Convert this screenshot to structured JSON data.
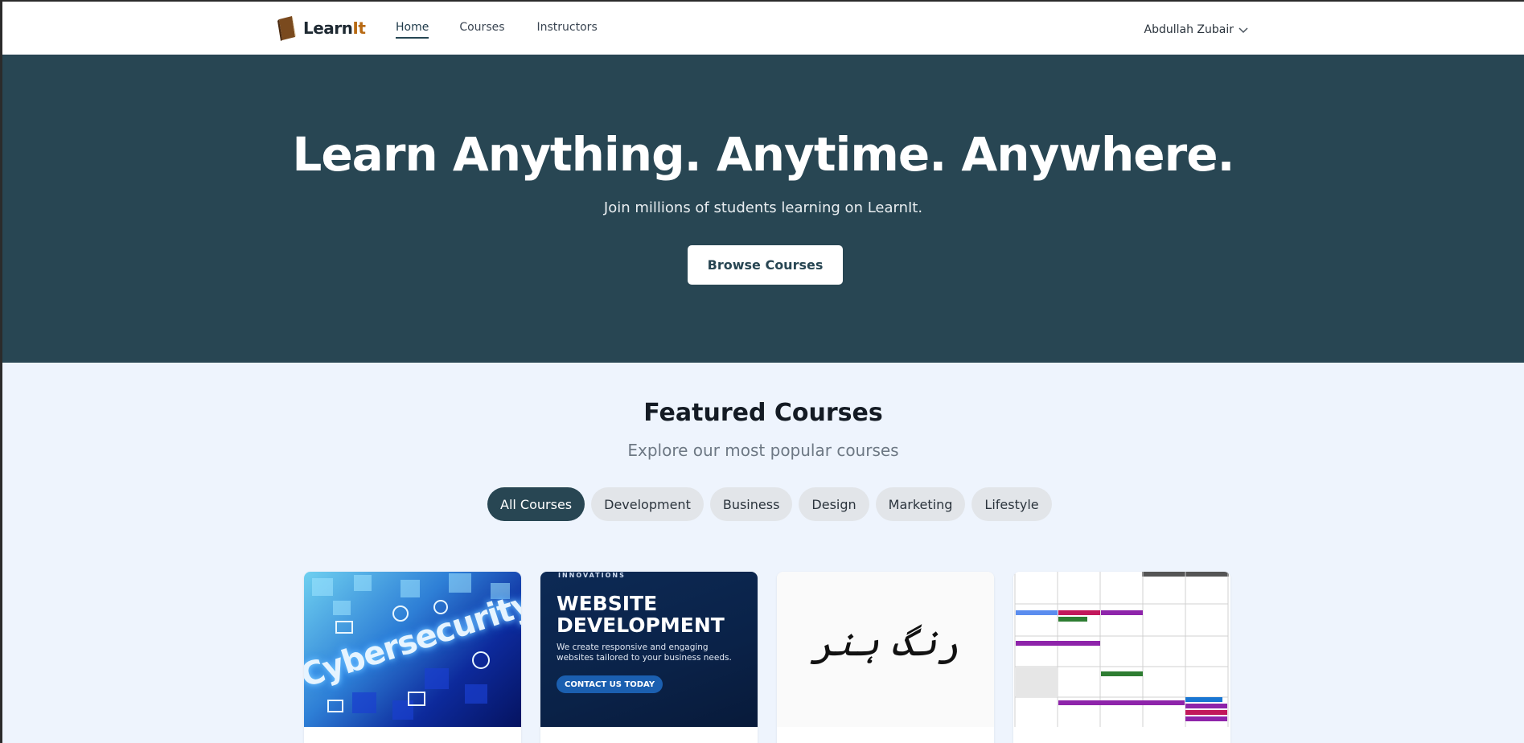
{
  "nav": {
    "brand_main": "Learn",
    "brand_accent": "It",
    "links": [
      "Home",
      "Courses",
      "Instructors"
    ],
    "active": "Home",
    "user_name": "Abdullah Zubair"
  },
  "hero": {
    "title": "Learn Anything. Anytime. Anywhere.",
    "subtitle": "Join millions of students learning on LearnIt.",
    "cta": "Browse Courses"
  },
  "featured": {
    "title": "Featured Courses",
    "subtitle": "Explore our most popular courses",
    "filters": [
      "All Courses",
      "Development",
      "Business",
      "Design",
      "Marketing",
      "Lifestyle"
    ],
    "active_filter": "All Courses"
  },
  "cards": [
    {
      "thumb_text": "Cybersecurity"
    },
    {
      "thumb_top": "INNOVATIONS",
      "thumb_title": "WEBSITE DEVELOPMENT",
      "thumb_desc": "We create responsive and engaging websites tailored to your business needs.",
      "thumb_cta": "CONTACT US TODAY"
    },
    {
      "thumb_text": "رنگ ہنر"
    },
    {
      "thumb_text": ""
    }
  ],
  "colors": {
    "primary": "#284653",
    "accent": "#b86a14",
    "page_bg": "#eef4fd"
  }
}
